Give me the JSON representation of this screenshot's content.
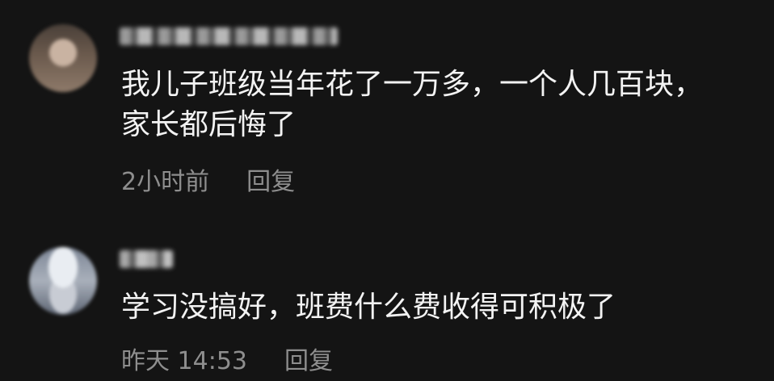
{
  "comments": [
    {
      "username": "",
      "text": "我儿子班级当年花了一万多，一个人几百块，\n家长都后悔了",
      "timestamp": "2小时前",
      "reply_label": "回复"
    },
    {
      "username": "",
      "text": "学习没搞好，班费什么费收得可积极了",
      "timestamp": "昨天 14:53",
      "reply_label": "回复"
    }
  ]
}
